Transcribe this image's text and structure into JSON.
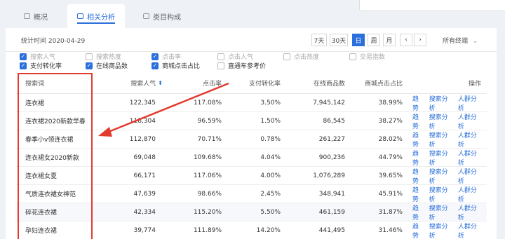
{
  "tabs": [
    {
      "label": "概况",
      "active": false
    },
    {
      "label": "相关分析",
      "active": true
    },
    {
      "label": "类目构成",
      "active": false
    }
  ],
  "stats": {
    "label": "统计时间 2020-04-29",
    "ranges": [
      "7天",
      "30天",
      "日",
      "周",
      "月"
    ],
    "active_range": "日",
    "prev": "‹",
    "next": "›",
    "terminal": "所有终端"
  },
  "options": [
    {
      "label": "搜索人气",
      "checked": true
    },
    {
      "label": "搜索热度",
      "checked": false
    },
    {
      "label": "点击率",
      "checked": true
    },
    {
      "label": "点击人气",
      "checked": false
    },
    {
      "label": "点击热度",
      "checked": false
    },
    {
      "label": "交易指数",
      "checked": false
    },
    {
      "label": "支付转化率",
      "checked": true
    },
    {
      "label": "在线商品数",
      "checked": true
    },
    {
      "label": "商城点击占比",
      "checked": true
    },
    {
      "label": "直通车参考价",
      "checked": false
    }
  ],
  "table": {
    "headers": {
      "keyword": "搜索词",
      "popularity": "搜索人气",
      "ctr": "点击率",
      "conversion": "支付转化率",
      "items": "在线商品数",
      "mall_share": "商城点击占比",
      "ops": "操作"
    },
    "sort_icon": "⬍",
    "ops": [
      "趋势",
      "搜索分析",
      "人群分析"
    ],
    "rows": [
      {
        "keyword": "连衣裙",
        "popularity": "122,345",
        "ctr": "117.08%",
        "conversion": "3.50%",
        "items": "7,945,142",
        "mall_share": "38.99%"
      },
      {
        "keyword": "连衣裙2020新款早春",
        "popularity": "118,304",
        "ctr": "96.59%",
        "conversion": "1.50%",
        "items": "86,545",
        "mall_share": "38.27%"
      },
      {
        "keyword": "春季小v领连衣裙",
        "popularity": "112,870",
        "ctr": "70.71%",
        "conversion": "0.78%",
        "items": "261,227",
        "mall_share": "28.02%"
      },
      {
        "keyword": "连衣裙女2020新款",
        "popularity": "69,048",
        "ctr": "109.68%",
        "conversion": "4.04%",
        "items": "900,236",
        "mall_share": "44.79%"
      },
      {
        "keyword": "连衣裙女夏",
        "popularity": "66,171",
        "ctr": "117.06%",
        "conversion": "4.00%",
        "items": "1,076,289",
        "mall_share": "39.65%"
      },
      {
        "keyword": "气质连衣裙女神范",
        "popularity": "47,639",
        "ctr": "98.66%",
        "conversion": "2.45%",
        "items": "348,941",
        "mall_share": "45.91%"
      },
      {
        "keyword": "碎花连衣裙",
        "popularity": "42,334",
        "ctr": "115.20%",
        "conversion": "5.50%",
        "items": "461,159",
        "mall_share": "31.87%"
      },
      {
        "keyword": "孕妇连衣裙",
        "popularity": "39,774",
        "ctr": "111.89%",
        "conversion": "14.20%",
        "items": "441,495",
        "mall_share": "31.46%"
      }
    ]
  },
  "colors": {
    "accent": "#2a6fdb",
    "annotation": "#e23b2e"
  }
}
